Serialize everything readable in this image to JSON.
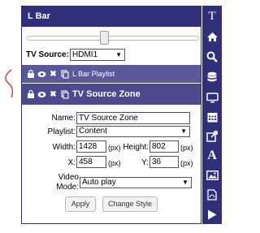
{
  "panel": {
    "title": "L Bar",
    "slider_level_fraction": 0.45,
    "tv_source": {
      "label": "TV Source:",
      "value": "HDMI1"
    }
  },
  "zones": [
    {
      "label": "L Bar Playlist"
    },
    {
      "label": "TV Source Zone"
    }
  ],
  "form": {
    "name": {
      "label": "Name:",
      "value": "TV Source Zone"
    },
    "playlist": {
      "label": "Playlist:",
      "value": "Content"
    },
    "width": {
      "label": "Width:",
      "value": "1428",
      "unit": "(px)"
    },
    "height": {
      "label": "Height:",
      "value": "802",
      "unit": "(px)"
    },
    "x": {
      "label": "X:",
      "value": "458",
      "unit": "(px)"
    },
    "y": {
      "label": "Y:",
      "value": "36",
      "unit": "(px)"
    },
    "video_mode": {
      "label_line1": "Video",
      "label_line2": "Mode:",
      "value": "Auto play"
    },
    "apply_label": "Apply",
    "change_style_label": "Change Style"
  },
  "toolbar": {
    "text_tool_label": "T",
    "font_tool_label": "A",
    "icons": [
      "text-icon",
      "home-icon",
      "search-icon",
      "database-icon",
      "monitor-icon",
      "calendar-icon",
      "external-link-icon",
      "font-icon",
      "image-icon",
      "pdf-file-icon",
      "play-icon"
    ]
  },
  "colors": {
    "header": "#2f2f7a",
    "zone_row": "#5a5a9a",
    "annotation": "#d04040"
  }
}
